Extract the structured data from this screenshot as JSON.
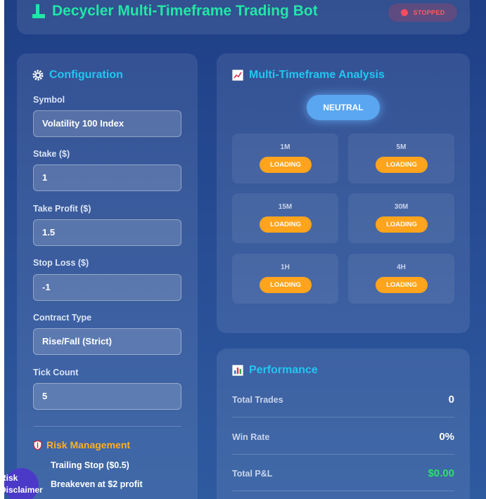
{
  "header": {
    "title": "Decycler Multi-Timeframe Trading Bot",
    "status": "STOPPED",
    "icon": "bot-icon"
  },
  "config": {
    "title": "Configuration",
    "fields": [
      {
        "label": "Symbol",
        "value": "Volatility 100 Index"
      },
      {
        "label": "Stake ($)",
        "value": "1"
      },
      {
        "label": "Take Profit ($)",
        "value": "1.5"
      },
      {
        "label": "Stop Loss ($)",
        "value": "-1"
      },
      {
        "label": "Contract Type",
        "value": "Rise/Fall (Strict)"
      },
      {
        "label": "Tick Count",
        "value": "5"
      }
    ],
    "risk": {
      "title": "Risk Management",
      "items": [
        "Trailing Stop ($0.5)",
        "Breakeven at $2 profit"
      ]
    }
  },
  "analysis": {
    "title": "Multi-Timeframe Analysis",
    "overall": "NEUTRAL",
    "timeframes": [
      {
        "label": "1M",
        "status": "LOADING"
      },
      {
        "label": "5M",
        "status": "LOADING"
      },
      {
        "label": "15M",
        "status": "LOADING"
      },
      {
        "label": "30M",
        "status": "LOADING"
      },
      {
        "label": "1H",
        "status": "LOADING"
      },
      {
        "label": "4H",
        "status": "LOADING"
      }
    ]
  },
  "performance": {
    "title": "Performance",
    "stats": [
      {
        "label": "Total Trades",
        "value": "0"
      },
      {
        "label": "Win Rate",
        "value": "0%"
      },
      {
        "label": "Total P&L",
        "value": "$0.00"
      }
    ]
  },
  "disclaimer": {
    "line1": "Risk",
    "line2": "Disclaimer"
  },
  "colors": {
    "accent_green": "#22e6a6",
    "accent_cyan": "#22c6f2",
    "warning_orange": "#ffa41c",
    "stopped_red": "#ff4b5c",
    "profit_green": "#2de06a"
  }
}
